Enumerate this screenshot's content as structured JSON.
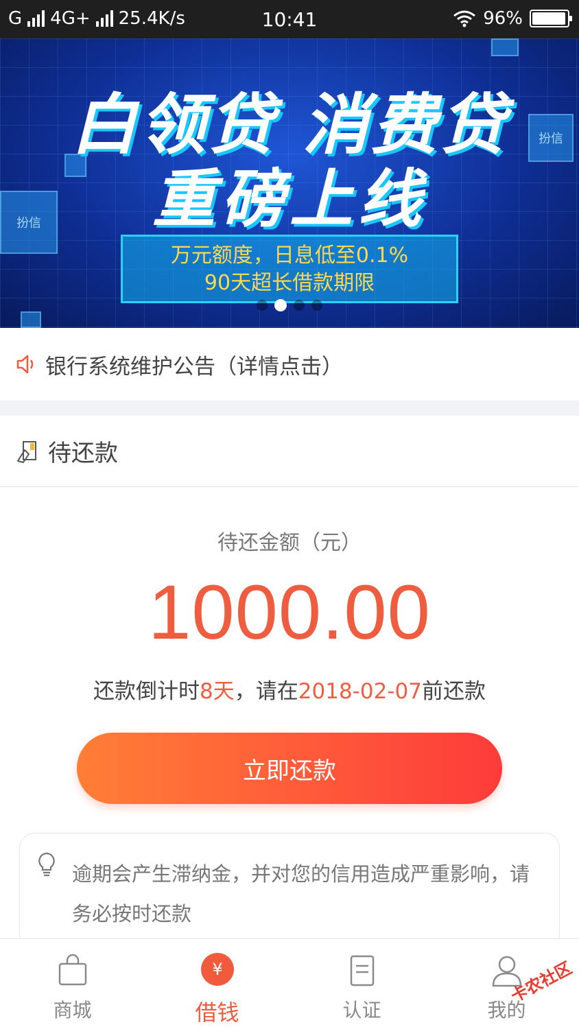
{
  "status_bar": {
    "carrier": "G",
    "network": "4G+",
    "speed": "25.4K/s",
    "time": "10:41",
    "battery": "96%",
    "battery_level": 0.96
  },
  "banner": {
    "title_line1": "白领贷 消费贷",
    "title_line2": "重磅上线",
    "sub_line1": "万元额度，日息低至0.1%",
    "sub_line2": "90天超长借款期限",
    "cube_logo": "扮信",
    "active_dot": 1,
    "dot_count": 4
  },
  "notice": {
    "text": "银行系统维护公告（详情点击）",
    "icon": "speaker-icon"
  },
  "repayment": {
    "section_title": "待还款",
    "amount_label": "待还金额（元）",
    "amount": "1000.00",
    "countdown_prefix": "还款倒计时",
    "countdown_days": "8天",
    "countdown_mid": "，请在",
    "due_date": "2018-02-07",
    "countdown_suffix": "前还款",
    "repay_button": "立即还款",
    "warning": "逾期会产生滞纳金，并对您的信用造成严重影响，请务必按时还款",
    "accent_color": "#ef5d40"
  },
  "tabbar": {
    "tabs": [
      {
        "label": "商城",
        "icon": "shopping-bag-icon"
      },
      {
        "label": "借钱",
        "icon": "yen-icon",
        "icon_glyph": "¥"
      },
      {
        "label": "认证",
        "icon": "document-icon"
      },
      {
        "label": "我的",
        "icon": "user-icon"
      }
    ],
    "active": 1
  },
  "watermark": "卡农社区"
}
